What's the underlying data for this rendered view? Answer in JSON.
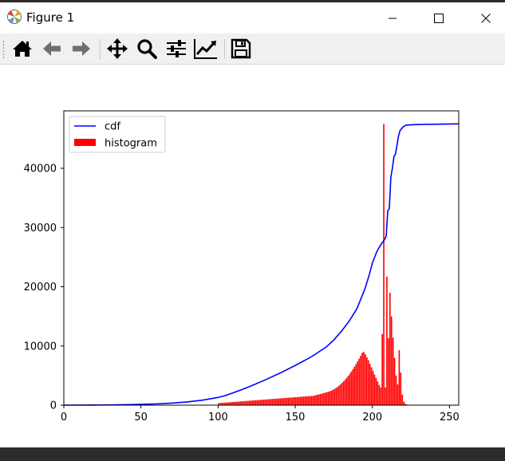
{
  "window": {
    "title": "Figure 1",
    "icons": {
      "app": "matplotlib-icon",
      "minimize": "minimize-icon",
      "maximize": "maximize-icon",
      "close": "close-icon"
    }
  },
  "toolbar": {
    "buttons": [
      {
        "name": "home-button",
        "icon": "home-icon"
      },
      {
        "name": "back-button",
        "icon": "arrow-left-icon"
      },
      {
        "name": "forward-button",
        "icon": "arrow-right-icon"
      },
      {
        "name": "pan-button",
        "icon": "move-icon"
      },
      {
        "name": "zoom-button",
        "icon": "magnifier-icon"
      },
      {
        "name": "subplots-button",
        "icon": "sliders-icon"
      },
      {
        "name": "edit-axes-button",
        "icon": "line-chart-icon"
      },
      {
        "name": "save-button",
        "icon": "floppy-disk-icon"
      }
    ]
  },
  "colors": {
    "cdf": "#0000ff",
    "histogram": "#ff0000",
    "toolbar_bg": "#f0f0f0"
  },
  "chart_data": {
    "type": "bar",
    "xlim": [
      0,
      256
    ],
    "ylim": [
      0,
      49700
    ],
    "xticks": [
      0,
      50,
      100,
      150,
      200,
      250
    ],
    "yticks": [
      0,
      10000,
      20000,
      30000,
      40000
    ],
    "legend": {
      "placement": "top-left",
      "entries": [
        "cdf",
        "histogram"
      ]
    },
    "grid": false,
    "series": [
      {
        "name": "cdf",
        "type": "line",
        "points": [
          [
            0,
            0
          ],
          [
            20,
            20
          ],
          [
            40,
            80
          ],
          [
            60,
            220
          ],
          [
            70,
            350
          ],
          [
            80,
            550
          ],
          [
            90,
            850
          ],
          [
            100,
            1300
          ],
          [
            105,
            1650
          ],
          [
            110,
            2100
          ],
          [
            115,
            2600
          ],
          [
            120,
            3100
          ],
          [
            130,
            4200
          ],
          [
            140,
            5400
          ],
          [
            150,
            6700
          ],
          [
            160,
            8100
          ],
          [
            170,
            9800
          ],
          [
            175,
            11000
          ],
          [
            180,
            12500
          ],
          [
            185,
            14200
          ],
          [
            190,
            16300
          ],
          [
            195,
            19500
          ],
          [
            198,
            22000
          ],
          [
            200,
            24000
          ],
          [
            203,
            26000
          ],
          [
            206,
            27300
          ],
          [
            208,
            28000
          ],
          [
            209,
            28600
          ],
          [
            210,
            32800
          ],
          [
            211,
            33200
          ],
          [
            212,
            38500
          ],
          [
            213,
            40000
          ],
          [
            214,
            42000
          ],
          [
            215,
            42400
          ],
          [
            217,
            45500
          ],
          [
            218,
            46400
          ],
          [
            220,
            47000
          ],
          [
            222,
            47300
          ],
          [
            230,
            47400
          ],
          [
            256,
            47500
          ]
        ]
      },
      {
        "name": "histogram",
        "type": "bar",
        "bin_width": 1,
        "x_start": 100,
        "values": [
          350,
          370,
          390,
          410,
          430,
          450,
          470,
          490,
          510,
          530,
          550,
          570,
          590,
          610,
          630,
          650,
          670,
          690,
          710,
          730,
          750,
          770,
          790,
          810,
          830,
          850,
          870,
          890,
          910,
          930,
          950,
          970,
          990,
          1010,
          1030,
          1050,
          1070,
          1090,
          1110,
          1130,
          1150,
          1170,
          1190,
          1210,
          1230,
          1250,
          1270,
          1290,
          1310,
          1330,
          1350,
          1370,
          1390,
          1410,
          1430,
          1450,
          1470,
          1490,
          1510,
          1530,
          1550,
          1570,
          1620,
          1690,
          1760,
          1830,
          1900,
          1970,
          2040,
          2110,
          2180,
          2250,
          2340,
          2450,
          2580,
          2730,
          2900,
          3090,
          3300,
          3530,
          3780,
          4050,
          4340,
          4650,
          4980,
          5330,
          5700,
          6090,
          6500,
          6930,
          7380,
          7850,
          8340,
          8850,
          9000,
          8600,
          8100,
          7600,
          7000,
          6400,
          5800,
          5200,
          4600,
          4000,
          3400,
          3000,
          12000,
          47500,
          3000,
          21700,
          11300,
          19000,
          15000,
          11400,
          8000,
          5000,
          3500,
          9300,
          5500,
          1800,
          600,
          250,
          120,
          60,
          30,
          20
        ]
      }
    ]
  }
}
